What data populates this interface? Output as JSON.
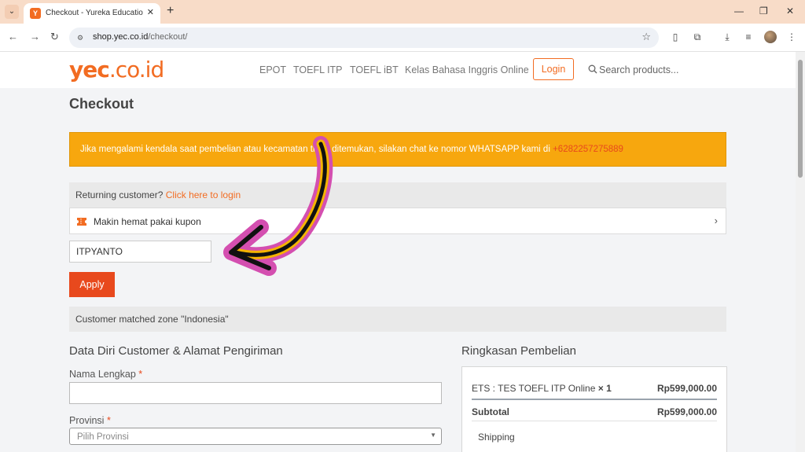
{
  "browser": {
    "tab_title": "Checkout - Yureka Education Ce",
    "favicon_letter": "Y",
    "url_host": "shop.yec.co.id",
    "url_path": "/checkout/"
  },
  "site": {
    "logo_main": "yec",
    "logo_domain": ".co.id",
    "menu": [
      "EPOT",
      "TOEFL ITP",
      "TOEFL iBT",
      "Kelas Bahasa Inggris Online"
    ],
    "login_label": "Login",
    "search_placeholder": "Search products..."
  },
  "checkout": {
    "title": "Checkout",
    "notice_text": "Jika mengalami kendala saat pembelian atau kecamatan tidak ditemukan, silakan chat ke nomor WHATSAPP kami di ",
    "notice_phone": "+6282257275889",
    "returning_text": "Returning customer? ",
    "returning_link": "Click here to login",
    "coupon_bar_text": "Makin hemat pakai kupon",
    "coupon_value": "ITPYANTO",
    "apply_label": "Apply",
    "zone_text": "Customer matched zone \"Indonesia\""
  },
  "billing": {
    "title": "Data Diri Customer & Alamat Pengiriman",
    "name_label": "Nama Lengkap ",
    "province_label": "Provinsi ",
    "required_mark": "*",
    "province_placeholder": "Pilih Provinsi"
  },
  "summary": {
    "title": "Ringkasan Pembelian",
    "item_name": "ETS : TES TOEFL ITP Online",
    "item_qty": "× 1",
    "item_price": "Rp599,000.00",
    "subtotal_label": "Subtotal",
    "subtotal_value": "Rp599,000.00",
    "shipping_label": "Shipping"
  },
  "colors": {
    "brand_orange": "#f26c22",
    "notice_bg": "#f7a70e",
    "apply_bg": "#e8491d",
    "annotation_pink": "#d44fb0",
    "annotation_yellow": "#f5b400"
  }
}
